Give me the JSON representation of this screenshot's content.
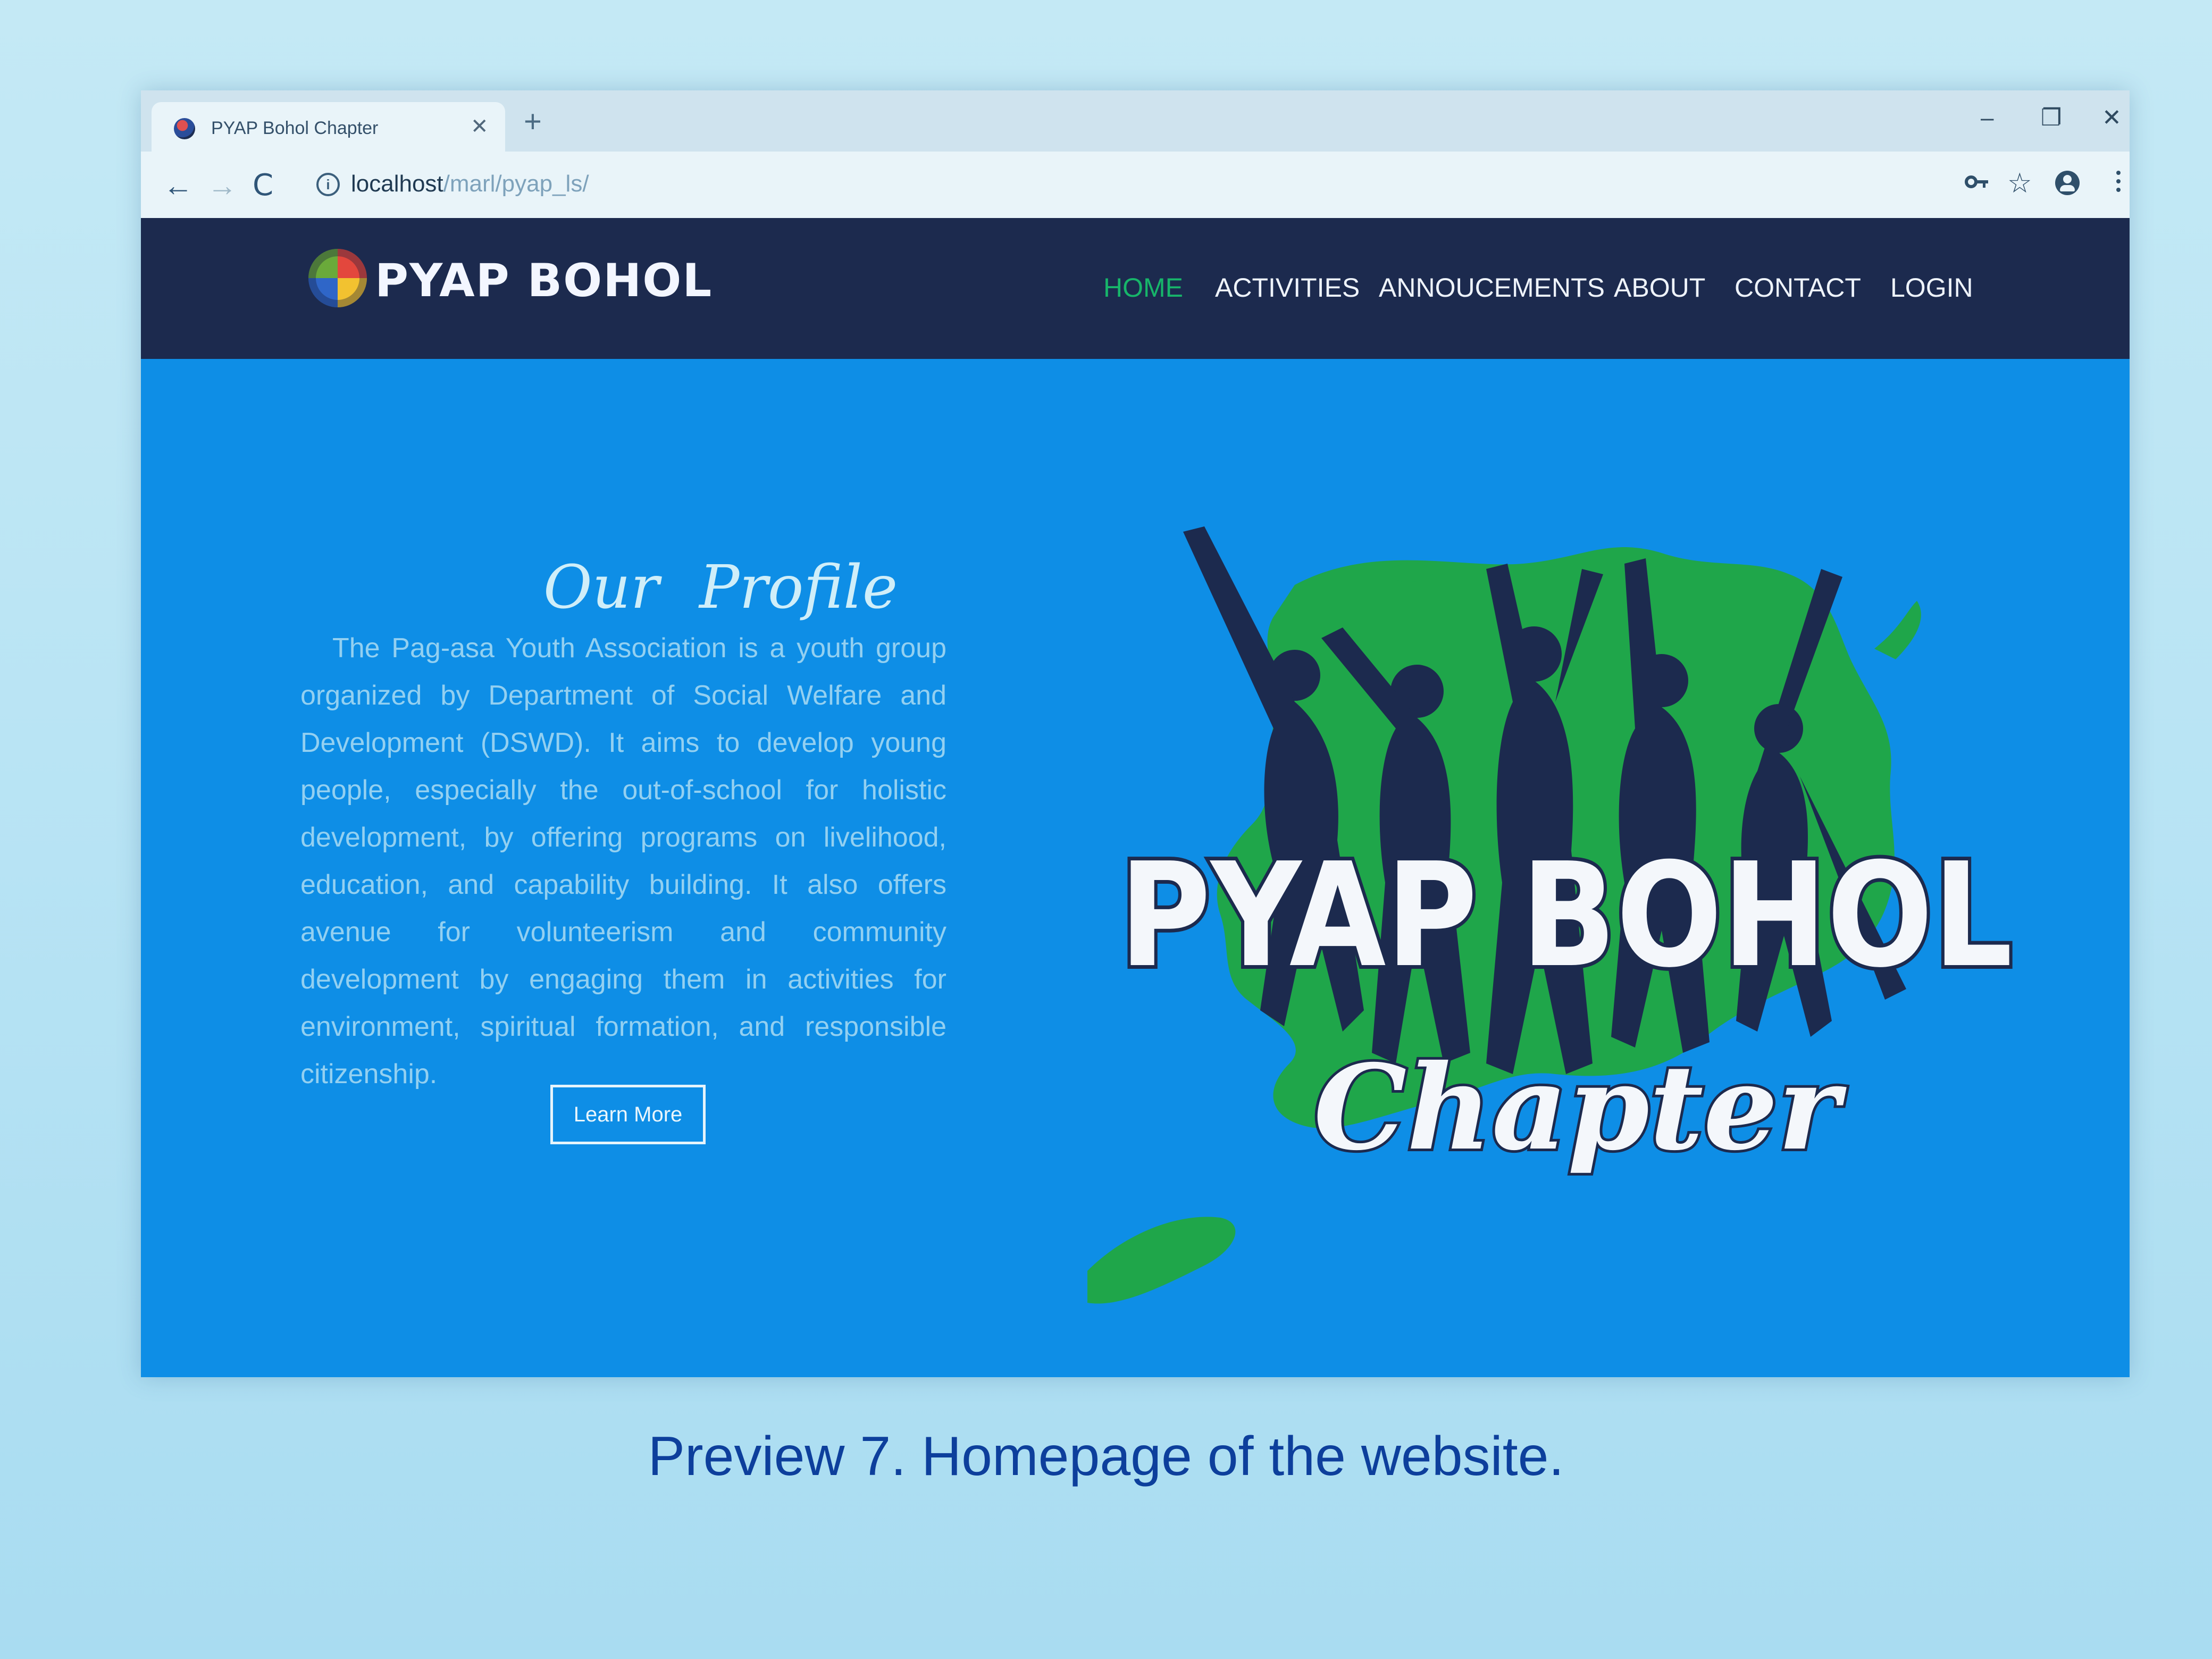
{
  "browser": {
    "tab_title": "PYAP Bohol Chapter",
    "tab_close_icon": "close-icon",
    "new_tab_label": "+",
    "window_controls": {
      "minimize": "–",
      "maximize": "❐",
      "close": "✕"
    },
    "nav": {
      "back": "←",
      "forward": "→",
      "reload": "C"
    },
    "url_host": "localhost",
    "url_path": "/marl/pyap_ls/",
    "icons": {
      "key": "key-icon",
      "star": "☆",
      "profile": "profile-icon",
      "menu": "menu-icon"
    }
  },
  "site": {
    "brand": "PYAP BOHOL",
    "menu": [
      "HOME",
      "ACTIVITIES",
      "ANNOUCEMENTS",
      "ABOUT",
      "CONTACT",
      "LOGIN"
    ],
    "active_menu": "HOME",
    "accent_color": "#17b56a",
    "header_color": "#1c2a4e",
    "hero_color": "#0e8ee6"
  },
  "hero": {
    "title": "Our Profile",
    "body": "The Pag-asa Youth Association is a youth group organized by Department of Social Welfare and Development (DSWD). It aims to develop young people, especially the out-of-school for holistic development, by offering programs on livelihood, education, and capability building. It also offers avenue for volunteerism and community development by engaging them in activities for environment, spiritual formation, and responsible citizenship.",
    "button": "Learn More",
    "art_title": "PYAP BOHOL",
    "art_subtitle": "Chapter"
  },
  "caption": "Preview 7. Homepage of the website."
}
